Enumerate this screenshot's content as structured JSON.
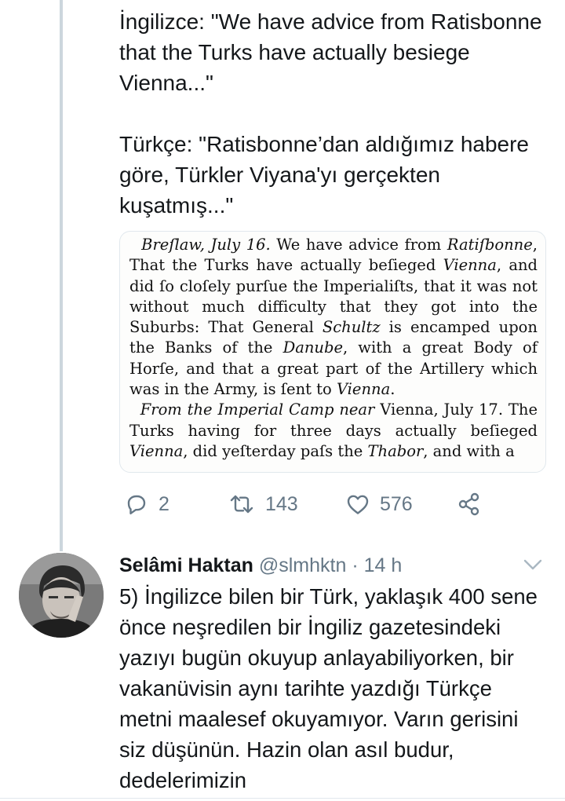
{
  "tweet": {
    "text": "İngilizce: \"We have advice from Ratisbonne that the Turks have actually besiege Vienna...\"\n\nTürkçe: \"Ratisbonne’dan aldığımız habere göre, Türkler Viyana'yı gerçekten kuşatmış...\"",
    "clipping": {
      "p1_a": "Breſlaw, July 16.",
      "p1_b": " We have advice from ",
      "p1_c": "Ratiſbonne",
      "p1_d": ", That the Turks have actually beſieged ",
      "p1_e": "Vienna",
      "p1_f": ", and did ſo cloſely purſue the Imperialiſts, that it was not without much difficulty that they got into the Suburbs: That General ",
      "p1_g": "Schultz",
      "p1_h": " is encamped upon the Banks of the ",
      "p1_i": "Danube",
      "p1_j": ", with a great Body of Horſe, and that a great part of the Artillery which was in the Army, is ſent to ",
      "p1_k": "Vienna",
      "p1_l": ".",
      "p2_a": "From the Imperial Camp near",
      "p2_b": " Vienna, July 17. The Turks having for three days actually beſieged ",
      "p2_c": "Vienna",
      "p2_d": ", did yeſterday paſs the ",
      "p2_e": "Thabor",
      "p2_f": ", and with a"
    },
    "actions": {
      "reply_count": "2",
      "retweet_count": "143",
      "like_count": "576"
    }
  },
  "reply": {
    "name": "Selâmi Haktan",
    "handle": "@slmhktn",
    "separator": " · ",
    "time": "14 h",
    "text": "5) İngilizce bilen bir Türk, yaklaşık 400 sene önce neşredilen bir İngiliz gazetesindeki yazıyı bugün okuyup anlayabiliyorken, bir vakanüvisin aynı tarihte yazdığı Türkçe metni maalesef okuyamıyor. Varın gerisini siz düşünün. Hazin olan asıl budur, dedelerimizin"
  },
  "colors": {
    "text": "#14171a",
    "secondary": "#657786",
    "thread_line": "#ccd6dd",
    "border": "#e1e8ed"
  },
  "icons": [
    "reply-icon",
    "retweet-icon",
    "like-icon",
    "share-icon",
    "chevron-down-icon",
    "avatar"
  ]
}
